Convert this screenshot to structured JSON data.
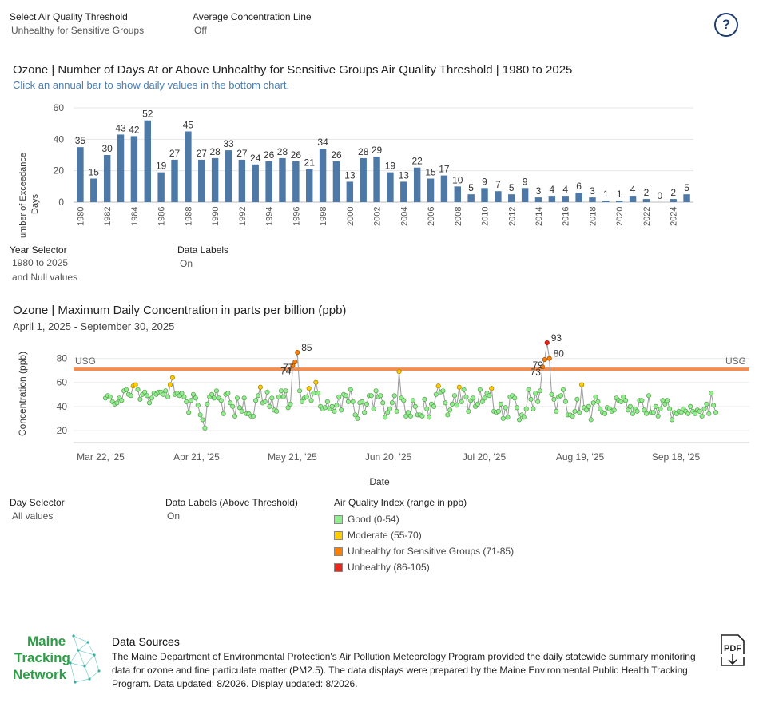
{
  "filters": {
    "threshold": {
      "label": "Select Air Quality Threshold",
      "value": "Unhealthy for Sensitive Groups"
    },
    "avg_line": {
      "label": "Average Concentration Line",
      "value": "Off"
    },
    "year_selector": {
      "label": "Year Selector",
      "value_line1": "1980 to 2025",
      "value_line2": "and Null values"
    },
    "data_labels": {
      "label": "Data Labels",
      "value": "On"
    },
    "day_selector": {
      "label": "Day Selector",
      "value": "All values"
    },
    "data_labels_above": {
      "label": "Data Labels (Above Threshold)",
      "value": "On"
    }
  },
  "help_icon": "?",
  "annual": {
    "title": "Ozone | Number of Days At or Above Unhealthy for Sensitive Groups Air Quality Threshold  | 1980 to 2025",
    "subtitle": "Click an annual bar to show daily values in the bottom chart.",
    "ylabel_line1": "Number of Exceedance",
    "ylabel_line2": "Days",
    "bar_color": "#4e79a7"
  },
  "daily": {
    "title": "Ozone | Maximum Daily Concentration in parts per billion (ppb)",
    "date_range": "April 1, 2025 - September 30, 2025",
    "ylabel": "Concentration (ppb)",
    "xlabel": "Date",
    "threshold_label_left": "USG",
    "threshold_label_right": "USG",
    "threshold_color": "#f28e50",
    "x_ticks": [
      "Mar 22, '25",
      "Apr 21, '25",
      "May 21, '25",
      "Jun 20, '25",
      "Jul 20, '25",
      "Aug 19, '25",
      "Sep 18, '25"
    ],
    "y_ticks": [
      "80",
      "60",
      "40",
      "20"
    ]
  },
  "legend": {
    "title": "Air Quality Index (range in ppb)",
    "items": [
      {
        "label": "Good (0-54)",
        "color": "#90ee90"
      },
      {
        "label": "Moderate (55-70)",
        "color": "#ffcc00"
      },
      {
        "label": "Unhealthy for Sensitive Groups (71-85)",
        "color": "#ff8000"
      },
      {
        "label": "Unhealthy (86-105)",
        "color": "#e8261b"
      }
    ]
  },
  "logo": {
    "line1": "Maine",
    "line2": "Tracking",
    "line3": "Network"
  },
  "sources": {
    "title": "Data Sources",
    "text": "The Maine Department of Environmental Protection's Air Pollution Meteorology Program provided the daily statewide summary monitoring data for ozone and fine particulate matter (PM2.5). The data displays were prepared by the Maine Environmental Public Health Tracking Program. Data updated: 8/2026. Display updated: 8/2026."
  },
  "pdf_label": "PDF",
  "chart_data": [
    {
      "type": "bar",
      "title": "Ozone | Number of Days At or Above Unhealthy for Sensitive Groups Air Quality Threshold  | 1980 to 2025",
      "ylabel": "Number of Exceedance Days",
      "ylim": [
        0,
        60
      ],
      "y_ticks": [
        0,
        20,
        40,
        60
      ],
      "x_tick_labels": [
        "1980",
        "1982",
        "1984",
        "1986",
        "1988",
        "1990",
        "1992",
        "1994",
        "1996",
        "1998",
        "2000",
        "2002",
        "2004",
        "2006",
        "2008",
        "2010",
        "2012",
        "2014",
        "2016",
        "2018",
        "2020",
        "2022",
        "2024"
      ],
      "categories": [
        "1980",
        "1981",
        "1982",
        "1983",
        "1984",
        "1985",
        "1986",
        "1987",
        "1988",
        "1989",
        "1990",
        "1991",
        "1992",
        "1993",
        "1994",
        "1995",
        "1996",
        "1997",
        "1998",
        "1999",
        "2000",
        "2001",
        "2002",
        "2003",
        "2004",
        "2005",
        "2006",
        "2007",
        "2008",
        "2009",
        "2010",
        "2011",
        "2012",
        "2013",
        "2014",
        "2015",
        "2016",
        "2017",
        "2018",
        "2019",
        "2020",
        "2021",
        "2022",
        "2023",
        "2024",
        "2025"
      ],
      "values": [
        35,
        15,
        30,
        43,
        42,
        52,
        19,
        27,
        45,
        27,
        28,
        33,
        27,
        24,
        26,
        28,
        26,
        21,
        34,
        26,
        13,
        28,
        29,
        19,
        13,
        22,
        15,
        17,
        10,
        5,
        9,
        7,
        5,
        9,
        3,
        4,
        4,
        6,
        3,
        1,
        1,
        4,
        2,
        0,
        2,
        5
      ],
      "grid": true
    },
    {
      "type": "scatter",
      "title": "Ozone | Maximum Daily Concentration in parts per billion (ppb)",
      "xlabel": "Date",
      "ylabel": "Concentration (ppb)",
      "ylim": [
        10,
        95
      ],
      "y_ticks": [
        20,
        40,
        60,
        80
      ],
      "threshold": {
        "label": "USG",
        "value": 71
      },
      "start_date": "2025-04-01",
      "values": [
        47,
        49,
        48,
        44,
        42,
        43,
        47,
        45,
        53,
        54,
        50,
        49,
        57,
        58,
        54,
        46,
        50,
        52,
        49,
        43,
        47,
        51,
        50,
        52,
        52,
        50,
        53,
        48,
        58,
        64,
        50,
        51,
        49,
        51,
        48,
        44,
        35,
        45,
        50,
        47,
        41,
        33,
        29,
        22,
        42,
        48,
        50,
        47,
        53,
        47,
        45,
        34,
        50,
        51,
        43,
        40,
        32,
        47,
        39,
        36,
        47,
        34,
        34,
        32,
        32,
        45,
        49,
        56,
        43,
        44,
        52,
        40,
        47,
        37,
        36,
        48,
        53,
        48,
        53,
        39,
        42,
        74,
        77,
        85,
        53,
        44,
        47,
        48,
        55,
        45,
        51,
        60,
        51,
        40,
        38,
        39,
        44,
        38,
        40,
        36,
        41,
        48,
        37,
        50,
        49,
        44,
        54,
        44,
        33,
        30,
        43,
        44,
        35,
        42,
        49,
        49,
        38,
        53,
        48,
        49,
        43,
        31,
        35,
        38,
        43,
        49,
        36,
        69,
        47,
        45,
        32,
        35,
        32,
        45,
        40,
        33,
        33,
        32,
        46,
        38,
        31,
        42,
        40,
        50,
        57,
        52,
        53,
        43,
        33,
        37,
        42,
        49,
        41,
        56,
        44,
        54,
        48,
        36,
        45,
        47,
        40,
        42,
        54,
        44,
        47,
        51,
        49,
        55,
        36,
        35,
        36,
        42,
        30,
        39,
        31,
        48,
        49,
        47,
        39,
        29,
        33,
        31,
        38,
        54,
        46,
        38,
        51,
        44,
        53,
        73,
        79,
        93,
        80,
        50,
        46,
        36,
        48,
        49,
        54,
        44,
        33,
        33,
        32,
        36,
        46,
        35,
        58,
        39,
        37,
        40,
        29,
        43,
        48,
        44,
        38,
        35,
        34,
        39,
        38,
        36,
        37,
        47,
        45,
        44,
        48,
        45,
        37,
        40,
        34,
        38,
        36,
        45,
        45,
        37,
        34,
        49,
        35,
        35,
        40,
        32,
        38,
        45,
        42,
        45,
        38,
        29,
        35,
        34,
        36,
        35,
        38,
        36,
        34,
        40,
        36,
        34,
        37,
        36,
        32,
        38,
        42,
        34,
        51,
        41,
        35
      ]
    }
  ]
}
